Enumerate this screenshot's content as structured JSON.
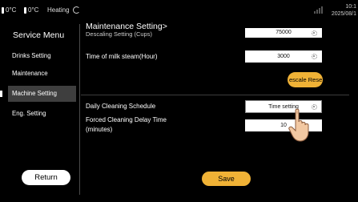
{
  "statusbar": {
    "temp1": "0°C",
    "temp2": "0°C",
    "heating": "Heating",
    "time": "10:1",
    "date": "2025/08/1"
  },
  "sidebar": {
    "title": "Service Menu",
    "items": [
      {
        "label": "Drinks Setting"
      },
      {
        "label": "Maintenance"
      },
      {
        "label": "Machine Setting",
        "active": true
      },
      {
        "label": "Eng. Setting"
      }
    ],
    "return_label": "Return"
  },
  "content": {
    "title": "Maintenance Setting>",
    "subtitle": "Descaling Setting (Cups)",
    "descaling_cups_value": "75000",
    "milk_steam_label": "Time of milk steam(Hour)",
    "milk_steam_value": "3000",
    "descale_reset_label": "escale Rese",
    "daily_cleaning_label": "Daily Cleaning Schedule",
    "time_setting_label": "Time setting",
    "forced_delay_label_1": "Forced Cleaning Delay Time",
    "forced_delay_label_2": "(minutes)",
    "forced_delay_value": "10",
    "save_label": "Save"
  },
  "colors": {
    "background": "#000000",
    "accent": "#f0b236",
    "active_menu_bg": "#3e3e3e"
  },
  "icons": [
    "thermometer-icon",
    "heating-icon",
    "signal-icon",
    "gear-icon",
    "hand-pointer-icon"
  ]
}
